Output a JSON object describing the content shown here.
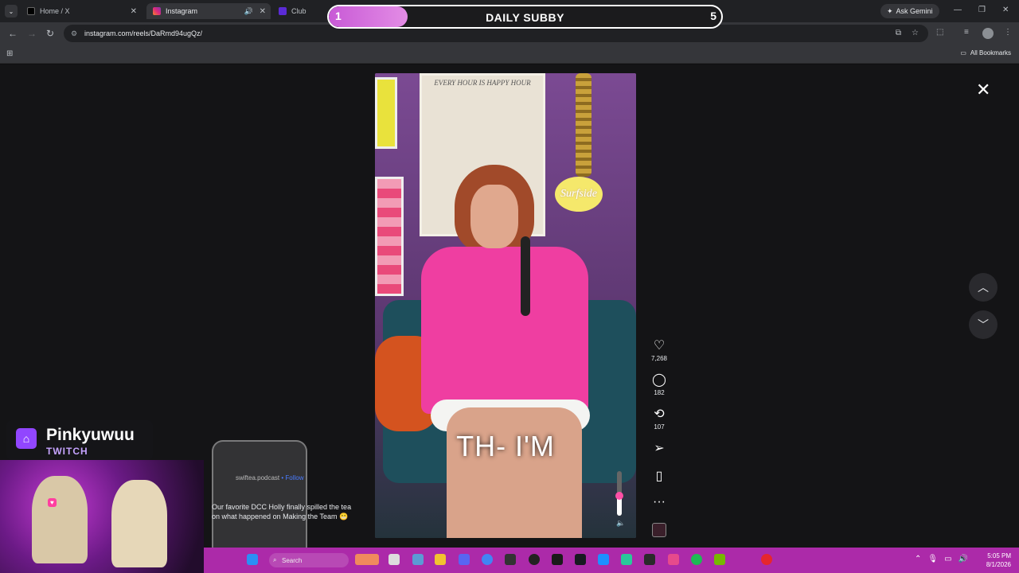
{
  "browser": {
    "tabs": [
      {
        "label": "Home / X"
      },
      {
        "label": "Instagram"
      },
      {
        "label": "Club"
      }
    ],
    "url": "instagram.com/reels/DaRmd94ugQz/",
    "ask_gemini": "Ask Gemini",
    "all_bookmarks": "All Bookmarks"
  },
  "subby_bar": {
    "start": "1",
    "title": "DAILY SUBBY",
    "end": "5",
    "progress_fraction": 0.2
  },
  "reel": {
    "poster_text": "EVERY HOUR IS HAPPY HOUR",
    "sign_text": "Surfside",
    "caption": "TH- I'M",
    "volume_fraction": 0.45
  },
  "actions": {
    "likes": "7,268",
    "comments": "182",
    "reposts": "107"
  },
  "stream_overlay": {
    "name": "Pinkyuwuu",
    "platform": "TWITCH",
    "handle": "swiftea.podcast",
    "follow": "Follow",
    "caption_line1": "Our favorite DCC Holly finally spilled the tea",
    "caption_line2": "on what happened on Making the Team 😬"
  },
  "taskbar": {
    "search_label": "Search",
    "time": "5:05 PM",
    "date": "8/1/2026"
  },
  "colors": {
    "accent_pink": "#ef3ea1",
    "twitch_purple": "#9146ff",
    "taskbar": "#ac2aa9"
  }
}
